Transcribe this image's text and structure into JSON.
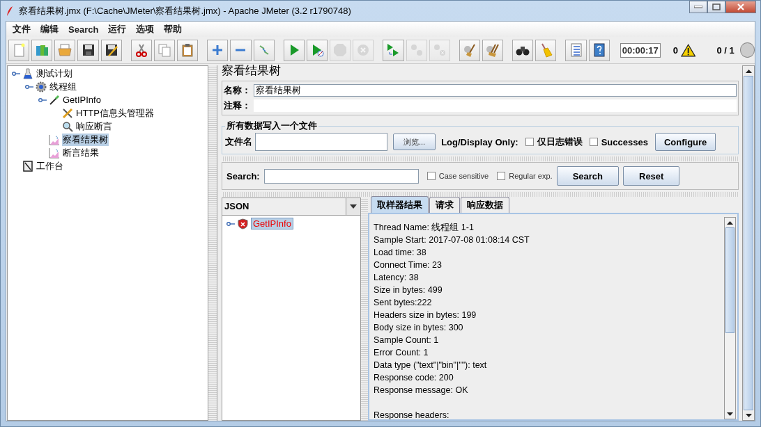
{
  "window": {
    "title": "察看结果树.jmx (F:\\Cache\\JMeter\\察看结果树.jmx) - Apache JMeter (3.2 r1790748)"
  },
  "menu": [
    "文件",
    "编辑",
    "Search",
    "运行",
    "选项",
    "帮助"
  ],
  "toolbar": [
    {
      "kind": "new",
      "disabled": false,
      "group_start": false
    },
    {
      "kind": "templates",
      "disabled": false,
      "group_start": false
    },
    {
      "kind": "open",
      "disabled": false,
      "group_start": false
    },
    {
      "kind": "save",
      "disabled": false,
      "group_start": false
    },
    {
      "kind": "saveas",
      "disabled": false,
      "group_start": false
    },
    {
      "kind": "cut",
      "disabled": false,
      "group_start": true
    },
    {
      "kind": "copy",
      "disabled": false,
      "group_start": false
    },
    {
      "kind": "paste",
      "disabled": false,
      "group_start": false
    },
    {
      "kind": "expand",
      "disabled": false,
      "group_start": true
    },
    {
      "kind": "collapse",
      "disabled": false,
      "group_start": false
    },
    {
      "kind": "toggle",
      "disabled": false,
      "group_start": false
    },
    {
      "kind": "start",
      "disabled": false,
      "group_start": true
    },
    {
      "kind": "start_no_pause",
      "disabled": false,
      "group_start": false
    },
    {
      "kind": "stop",
      "disabled": true,
      "group_start": false
    },
    {
      "kind": "shutdown",
      "disabled": true,
      "group_start": false
    },
    {
      "kind": "remote_start",
      "disabled": false,
      "group_start": true
    },
    {
      "kind": "remote_stop",
      "disabled": true,
      "group_start": false
    },
    {
      "kind": "remote_exit",
      "disabled": true,
      "group_start": false
    },
    {
      "kind": "clear",
      "disabled": false,
      "group_start": true
    },
    {
      "kind": "clear_all",
      "disabled": false,
      "group_start": false
    },
    {
      "kind": "search",
      "disabled": false,
      "group_start": true
    },
    {
      "kind": "reset_search",
      "disabled": false,
      "group_start": false
    },
    {
      "kind": "functions",
      "disabled": false,
      "group_start": true
    },
    {
      "kind": "help",
      "disabled": false,
      "group_start": false
    }
  ],
  "status": {
    "timer": "00:00:17",
    "warnings": "0",
    "threads": "0 / 1"
  },
  "tree": [
    {
      "label": "测试计划",
      "kind": "plan",
      "selected": false,
      "children": [
        {
          "label": "线程组",
          "kind": "threadgroup",
          "selected": false,
          "children": [
            {
              "label": "GetIPInfo",
              "kind": "sampler",
              "selected": false,
              "children": [
                {
                  "label": "HTTP信息头管理器",
                  "kind": "config",
                  "selected": false
                },
                {
                  "label": "响应断言",
                  "kind": "assertion",
                  "selected": false
                }
              ]
            },
            {
              "label": "察看结果树",
              "kind": "listener",
              "selected": true
            },
            {
              "label": "断言结果",
              "kind": "listener",
              "selected": false
            }
          ]
        }
      ]
    },
    {
      "label": "工作台",
      "kind": "workbench",
      "selected": false
    }
  ],
  "panel": {
    "title": "察看结果树",
    "name_label": "名称：",
    "name_value": "察看结果树",
    "comment_label": "注释：",
    "file_group": "所有数据写入一个文件",
    "file_label": "文件名",
    "browse": "浏览...",
    "log_label": "Log/Display Only:",
    "options": [
      {
        "label": "仅日志错误",
        "checked": false
      },
      {
        "label": "Successes",
        "checked": false
      }
    ],
    "configure": "Configure"
  },
  "search": {
    "label": "Search:",
    "options": [
      {
        "label": "Case sensitive",
        "checked": false
      },
      {
        "label": "Regular exp.",
        "checked": false
      }
    ],
    "buttons": [
      "Search",
      "Reset"
    ]
  },
  "results": {
    "renderer": "JSON",
    "items": [
      {
        "label": "GetIPInfo",
        "failed": true,
        "selected": true
      }
    ],
    "tabs": [
      {
        "label": "取样器结果",
        "selected": true
      },
      {
        "label": "请求",
        "selected": false
      },
      {
        "label": "响应数据",
        "selected": false
      }
    ],
    "lines": [
      "Thread Name: 线程组 1-1",
      "Sample Start: 2017-07-08 01:08:14 CST",
      "Load time: 38",
      "Connect Time: 23",
      "Latency: 38",
      "Size in bytes: 499",
      "Sent bytes:222",
      "Headers size in bytes: 199",
      "Body size in bytes: 300",
      "Sample Count: 1",
      "Error Count: 1",
      "Data type (\"text\"|\"bin\"|\"\"): text",
      "Response code: 200",
      "Response message: OK"
    ],
    "headers_heading": "Response headers:"
  }
}
